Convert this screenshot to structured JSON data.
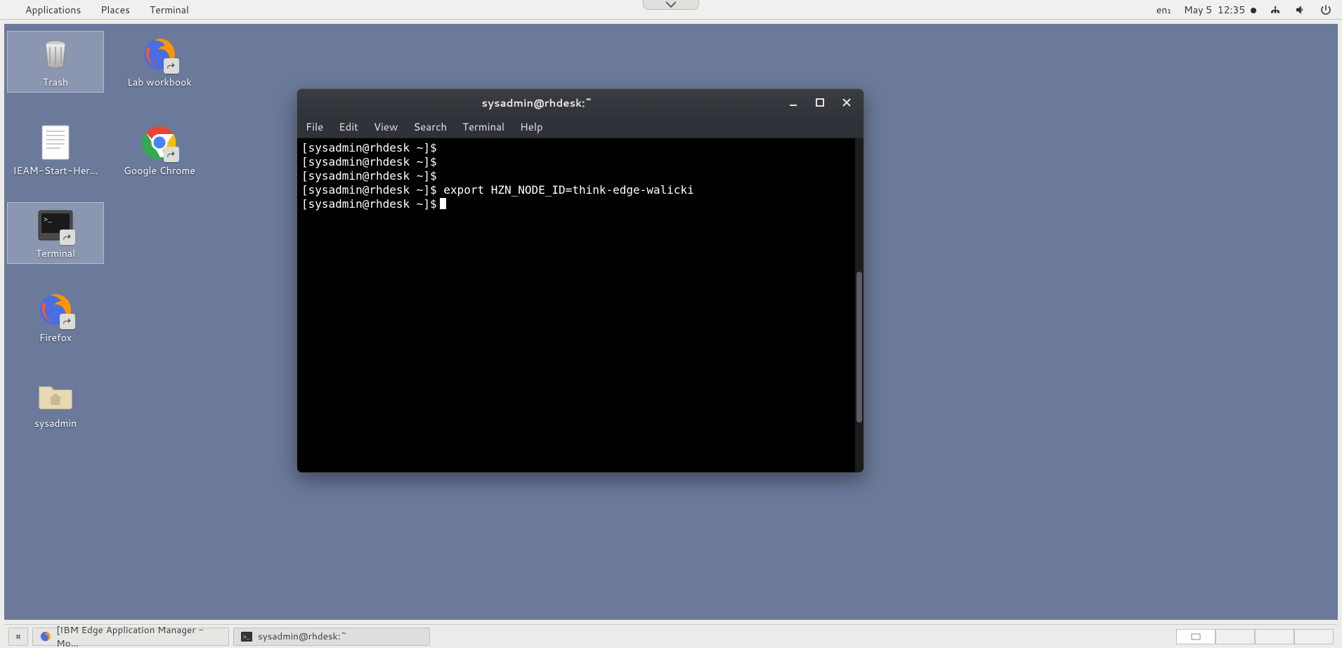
{
  "panel": {
    "menus": [
      "Applications",
      "Places",
      "Terminal"
    ],
    "input_lang": "en₁",
    "date": "May 5",
    "time": "12:35"
  },
  "desktop": {
    "col1": [
      {
        "name": "trash",
        "label": "Trash",
        "selected": true
      },
      {
        "name": "ieam-doc",
        "label": "IEAM-Start-Her…",
        "selected": false
      },
      {
        "name": "terminal",
        "label": "Terminal",
        "selected": true
      },
      {
        "name": "firefox",
        "label": "Firefox",
        "selected": false
      },
      {
        "name": "sysadmin",
        "label": "sysadmin",
        "selected": false
      }
    ],
    "col2": [
      {
        "name": "lab-workbook",
        "label": "Lab workbook",
        "selected": false
      },
      {
        "name": "google-chrome",
        "label": "Google Chrome",
        "selected": false
      }
    ]
  },
  "terminal": {
    "title": "sysadmin@rhdesk:~",
    "menus": [
      "File",
      "Edit",
      "View",
      "Search",
      "Terminal",
      "Help"
    ],
    "lines": [
      {
        "prompt": "[sysadmin@rhdesk ~]$",
        "cmd": ""
      },
      {
        "prompt": "[sysadmin@rhdesk ~]$",
        "cmd": ""
      },
      {
        "prompt": "[sysadmin@rhdesk ~]$",
        "cmd": ""
      },
      {
        "prompt": "[sysadmin@rhdesk ~]$",
        "cmd": " export HZN_NODE_ID=think-edge-walicki"
      },
      {
        "prompt": "[sysadmin@rhdesk ~]$",
        "cmd": "",
        "cursor": true
      }
    ]
  },
  "taskbar": {
    "items": [
      {
        "name": "firefox-task",
        "label": "[IBM Edge Application Manager - Mo…"
      },
      {
        "name": "terminal-task",
        "label": "sysadmin@rhdesk:~"
      }
    ]
  }
}
